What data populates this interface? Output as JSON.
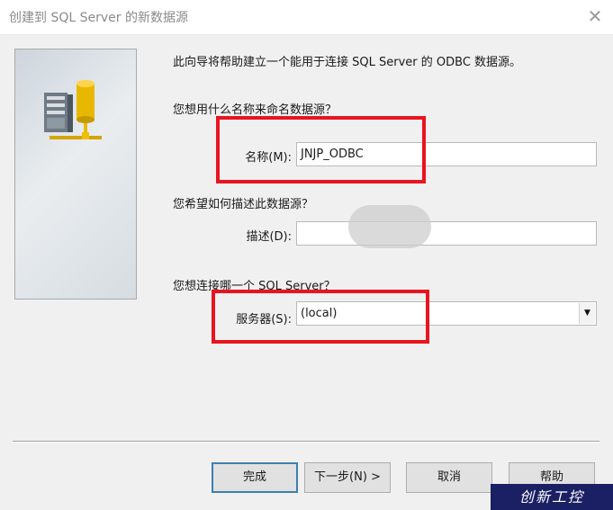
{
  "window": {
    "title": "创建到 SQL Server 的新数据源",
    "close_glyph": "✕"
  },
  "intro_text": "此向导将帮助建立一个能用于连接 SQL Server 的 ODBC 数据源。",
  "name_section": {
    "question": "您想用什么名称来命名数据源？",
    "label": "名称(M):",
    "value": "JNJP_ODBC"
  },
  "description_section": {
    "question": "您希望如何描述此数据源？",
    "label": "描述(D):",
    "value": ""
  },
  "server_section": {
    "question": "您想连接哪一个 SQL Server？",
    "label": "服务器(S):",
    "value": "(local)",
    "arrow": "▼"
  },
  "buttons": {
    "finish": "完成",
    "next": "下一步(N) >",
    "cancel": "取消",
    "help": "帮助"
  },
  "watermark": "创新工控",
  "colors": {
    "highlight_box": "#e8151f",
    "dialog_bg": "#f0f0f0",
    "title_text": "#8a8a8a",
    "watermark_bg": "#1b1f64"
  },
  "icons": [
    "database-server-icon",
    "close-icon",
    "dropdown-arrow-icon"
  ]
}
